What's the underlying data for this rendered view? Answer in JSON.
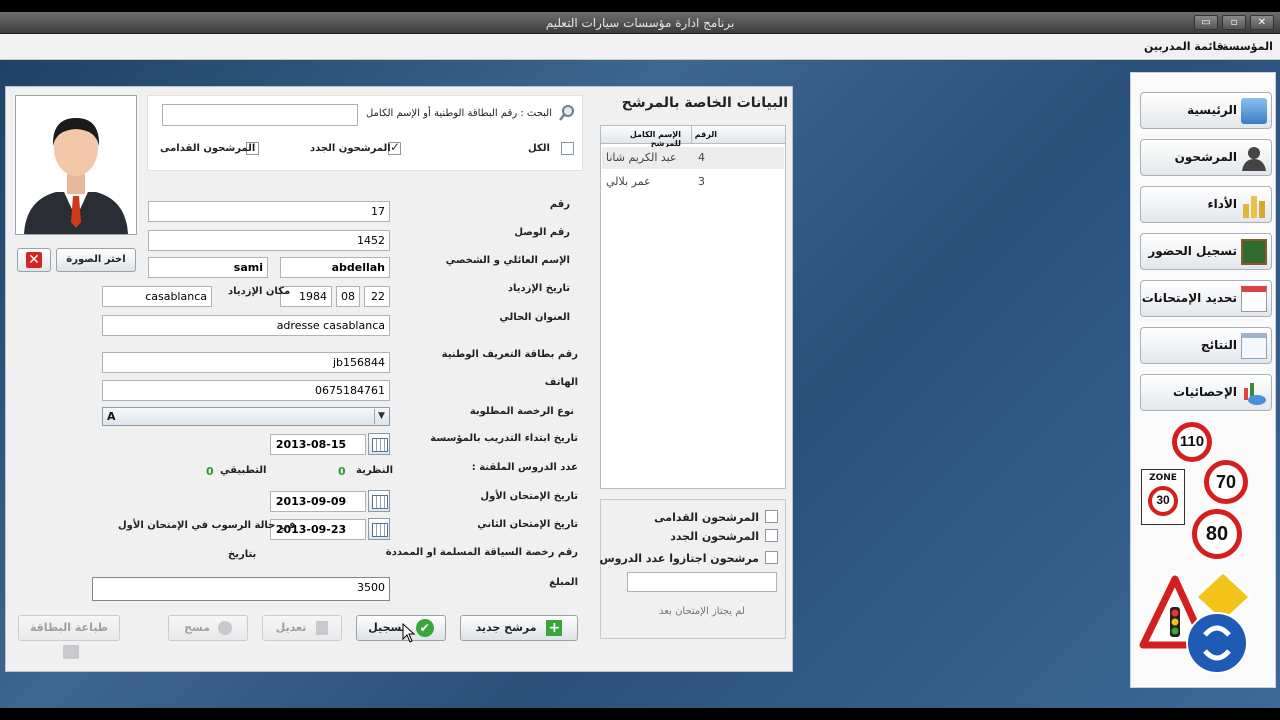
{
  "window": {
    "title": "برنامج ادارة مؤسسات سيارات التعليم",
    "controls": [
      "▭",
      "▫",
      "✕"
    ]
  },
  "menu": {
    "items": [
      "المؤسسة",
      "قائمة المدربين"
    ]
  },
  "search": {
    "label": "البحث : رقم البطاقة الوطنية أو الإسم الكامل",
    "value": ""
  },
  "filters": {
    "all": {
      "label": "الكل",
      "checked": false
    },
    "new": {
      "label": "المرشحون الجدد",
      "checked": true
    },
    "old": {
      "label": "المرشحون القدامى",
      "checked": false
    }
  },
  "photo": {
    "choose_label": "اختر الصورة"
  },
  "fields": {
    "number": {
      "label": "رقم",
      "value": "17"
    },
    "receipt": {
      "label": "رقم الوصل",
      "value": "1452"
    },
    "name": {
      "label": "الإسم العائلي و الشخصي",
      "last": "abdellah",
      "first": "sami"
    },
    "birth": {
      "label": "تاريخ الإزدياد",
      "day": "22",
      "month": "08",
      "year": "1984",
      "place_label": "مكان الإزدياد",
      "place": "casablanca"
    },
    "address": {
      "label": "العنوان الحالي",
      "value": "adresse casablanca"
    },
    "cin": {
      "label": "رقم بطاقة التعريف الوطنية",
      "value": "jb156844"
    },
    "phone": {
      "label": "الهاتف",
      "value": "0675184761"
    },
    "license_type": {
      "label": "نوع الرخصة المطلوبة",
      "value": "A"
    },
    "start_date": {
      "label": "تاريخ ابتداء التدريب بالمؤسسة",
      "value": "2013-08-15"
    },
    "lessons": {
      "label": "عدد الدروس الملقنة :",
      "theory_label": "النظرية",
      "theory": "0",
      "practice_label": "التطبيقي",
      "practice": "0"
    },
    "exam1": {
      "label": "تاريخ الإمتحان الأول",
      "value": "2013-09-09"
    },
    "exam2": {
      "label": "تاريخ الإمتحان الثاني",
      "value": "2013-09-23",
      "note": "في حالة الرسوب في الإمتحان الأول"
    },
    "license_no": {
      "label": "رقم رخصة السياقة المسلمة او الممددة",
      "note": "بتاريخ"
    },
    "amount": {
      "label": "المبلغ",
      "value": "3500"
    }
  },
  "buttons": {
    "print_card": "طباعة البطاقة",
    "delete": "مسح",
    "edit": "تعديل",
    "save": "تسجيل",
    "new_candidate": "مرشح جديد"
  },
  "candidates": {
    "title": "البيانات الخاصة بالمرشح",
    "columns": [
      "الرقم",
      "الإسم الكامل للمرشح"
    ],
    "rows": [
      {
        "id": "4",
        "name": "عبد الكريم شانا"
      },
      {
        "id": "3",
        "name": "عمر بلالي"
      }
    ]
  },
  "side_filters": {
    "old": "المرشحون القدامى",
    "new": "المرشحون الجدد",
    "passed": "مرشحون اجتازوا عدد الدروس",
    "value": "",
    "note": "لم يجتاز الإمتحان بعد"
  },
  "nav": [
    {
      "label": "الرئيسية",
      "icon": "home-icon"
    },
    {
      "label": "المرشحون",
      "icon": "person-icon"
    },
    {
      "label": "الأداء",
      "icon": "coins-icon"
    },
    {
      "label": "تسجيل الحضور",
      "icon": "blackboard-icon"
    },
    {
      "label": "تحديد الإمتحانات",
      "icon": "calendar-icon"
    },
    {
      "label": "النتائج",
      "icon": "window-icon"
    },
    {
      "label": "الإحصائيات",
      "icon": "chart-icon"
    }
  ],
  "signs": {
    "speed1": "110",
    "zone_label": "ZONE",
    "zone_speed": "30",
    "speed2": "70",
    "speed3": "80"
  }
}
